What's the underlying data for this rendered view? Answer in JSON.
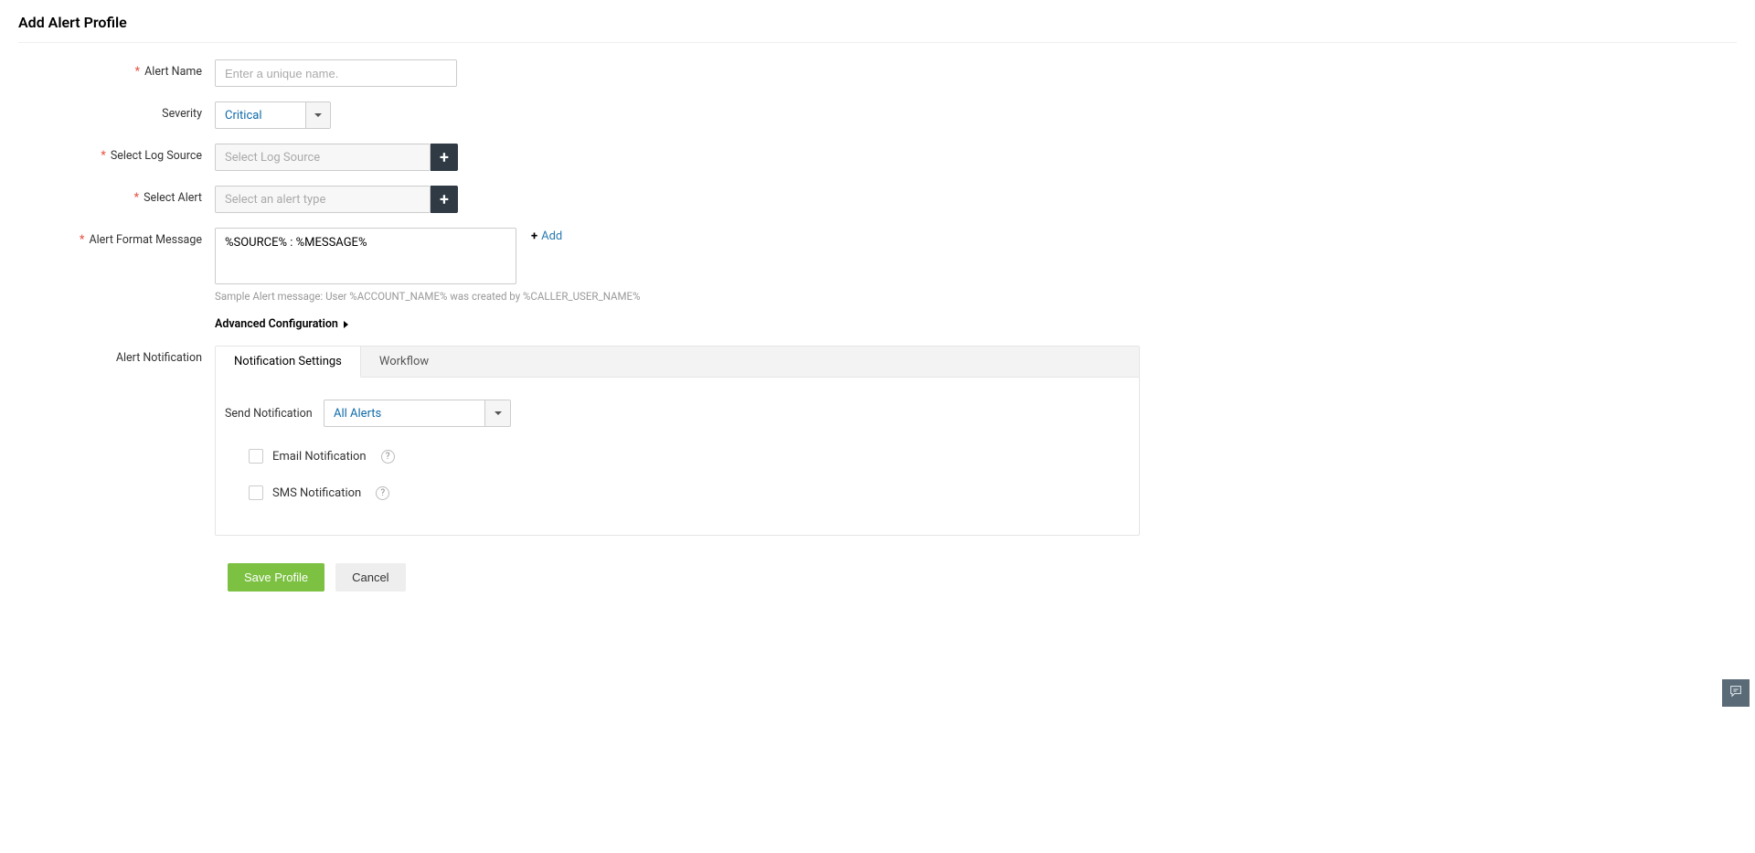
{
  "page": {
    "title": "Add Alert Profile"
  },
  "form": {
    "alert_name": {
      "label": "Alert Name",
      "placeholder": "Enter a unique name.",
      "value": ""
    },
    "severity": {
      "label": "Severity",
      "value": "Critical"
    },
    "log_source": {
      "label": "Select Log Source",
      "placeholder": "Select Log Source"
    },
    "select_alert": {
      "label": "Select Alert",
      "placeholder": "Select an alert type"
    },
    "format_msg": {
      "label": "Alert Format Message",
      "value": "%SOURCE% : %MESSAGE%",
      "hint": "Sample Alert message: User %ACCOUNT_NAME% was created by %CALLER_USER_NAME%",
      "add_link": "Add"
    },
    "advanced_config": "Advanced Configuration",
    "notification": {
      "label": "Alert Notification",
      "tabs": {
        "settings": "Notification Settings",
        "workflow": "Workflow"
      },
      "send_label": "Send Notification",
      "send_value": "All Alerts",
      "email_label": "Email Notification",
      "sms_label": "SMS Notification"
    }
  },
  "buttons": {
    "save": "Save Profile",
    "cancel": "Cancel"
  }
}
